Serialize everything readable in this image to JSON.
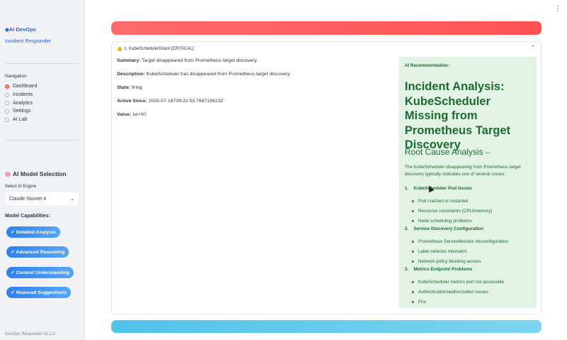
{
  "sidebar": {
    "brand": "AI DevOps",
    "subtitle": "Incident Responder",
    "nav_title": "Navigation",
    "nav_items": [
      "Dashboard",
      "Incidents",
      "Analytics",
      "Settings",
      "AI Lab"
    ],
    "selected_nav": "Dashboard",
    "ai_section_title": "AI Model Selection",
    "engine_label": "Select AI Engine",
    "engine_value": "Claude Sonnet 4",
    "capabilities_title": "Model Capabilities:",
    "capabilities": [
      "✓ Detailed Analysis",
      "✓ Advanced Reasoning",
      "✓ Context Understanding",
      "✓ Nuanced Suggestions"
    ],
    "version": "DevOps Responder v2.1.0"
  },
  "alert": {
    "title": "1. KubeSchedulerDown [CRITICAL]",
    "summary_label": "Summary:",
    "summary": "Target disappeared from Prometheus target discovery.",
    "description_label": "Description:",
    "description": "KubeScheduler has disappeared from Prometheus target discovery.",
    "state_label": "State:",
    "state": "firing",
    "active_label": "Active Since:",
    "active_since": "2025-07-18T09:22:53.768715623Z",
    "value_label": "Value:",
    "value": "1e+00"
  },
  "recommendation": {
    "label": "AI Recommendation:",
    "heading": "Incident Analysis: KubeScheduler Missing from Prometheus Target Discovery",
    "subheading": "Root Cause Analysis",
    "intro": "The KubeScheduler disappearing from Prometheus target discovery typically indicates one of several issues:",
    "sections": [
      {
        "number": "1.",
        "title": "KubeScheduler Pod Issues",
        "items": [
          "Pod crashed or restarted",
          "Resource constraints (CPU/memory)",
          "Node scheduling problems"
        ]
      },
      {
        "number": "2.",
        "title": "Service Discovery Configuration",
        "items": [
          "Prometheus ServiceMonitor misconfiguration",
          "Label selector mismatch",
          "Network policy blocking access"
        ]
      },
      {
        "number": "3.",
        "title": "Metrics Endpoint Problems",
        "items": [
          "KubeScheduler metrics port not accessible",
          "Authentication/authorization issues",
          "Fire"
        ]
      }
    ]
  },
  "colors": {
    "accent_blue": "#2f5fcf",
    "critical_red": "#ff5252",
    "success_green": "#1d6a30",
    "info_blue": "#4fc3e8"
  }
}
